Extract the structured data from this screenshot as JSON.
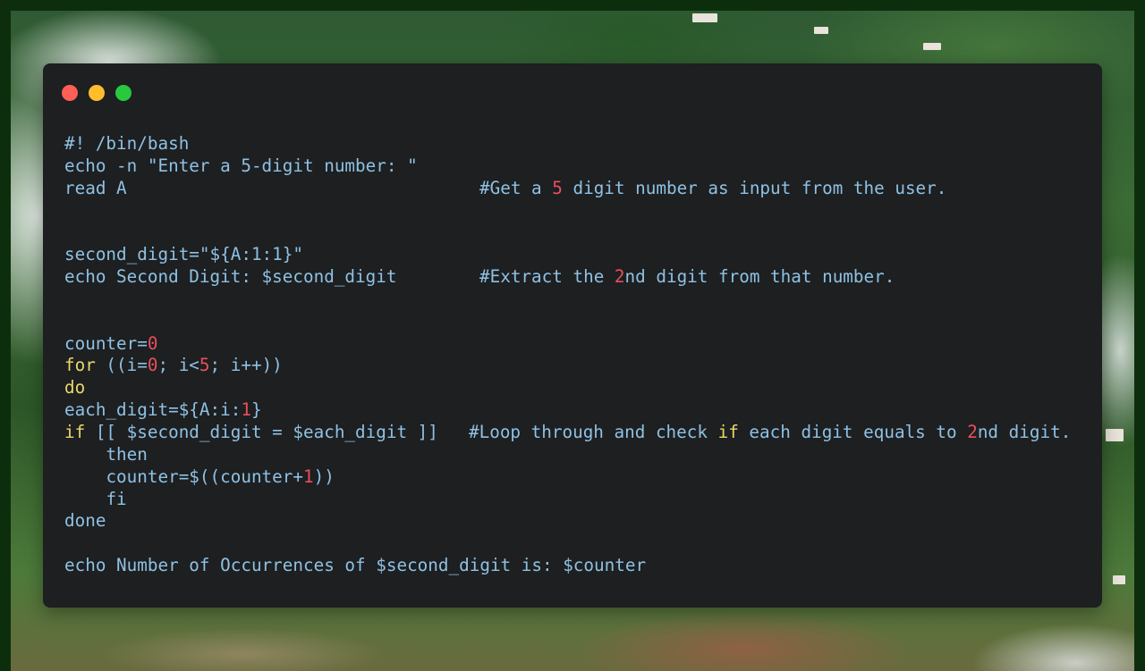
{
  "window": {
    "controls": {
      "close_color": "#ff5f56",
      "minimize_color": "#ffbd2e",
      "maximize_color": "#27c93f"
    }
  },
  "colors": {
    "text": "#8fc1e3",
    "keyword": "#e8d86b",
    "number": "#e8505b",
    "background": "#1d1f21"
  },
  "code": {
    "l01": "#! /bin/bash",
    "l02": "echo -n \"Enter a 5-digit number: \"",
    "l03_code": "read A",
    "l03_c1": "#Get a ",
    "l03_n": "5",
    "l03_c2": " digit number as input from the user.",
    "l06": "second_digit=\"${A:1:1}\"",
    "l07_code": "echo Second Digit: $second_digit",
    "l07_c1": "#Extract the ",
    "l07_n": "2",
    "l07_c2": "nd digit from that number.",
    "l10_a": "counter=",
    "l10_n": "0",
    "l11_kw": "for",
    "l11_a": " ((i=",
    "l11_n1": "0",
    "l11_b": "; i<",
    "l11_n2": "5",
    "l11_c": "; i++))",
    "l12_kw": "do",
    "l13_a": "each_digit=${A:i:",
    "l13_n": "1",
    "l13_b": "}",
    "l14_kw": "if",
    "l14_code": " [[ $second_digit = $each_digit ]]",
    "l14_c1": "#Loop through and check ",
    "l14_kw2": "if",
    "l14_c2": " each digit equals to ",
    "l14_n": "2",
    "l14_c3": "nd digit.",
    "l15_kw": "then",
    "l16_a": "counter=$((counter+",
    "l16_n": "1",
    "l16_b": "))",
    "l17_kw": "fi",
    "l18_kw": "done",
    "l20": "echo Number of Occurrences of $second_digit is: $counter"
  }
}
